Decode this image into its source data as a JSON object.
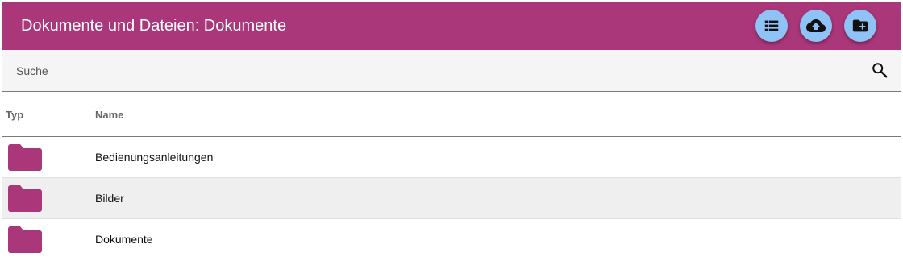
{
  "header": {
    "title": "Dokumente und Dateien: Dokumente",
    "accent_color": "#a9377a",
    "button_color": "#8fc2f5",
    "actions": [
      {
        "icon": "list-view-icon"
      },
      {
        "icon": "cloud-upload-icon"
      },
      {
        "icon": "create-folder-icon"
      }
    ]
  },
  "search": {
    "placeholder": "Suche",
    "icon": "search-icon"
  },
  "table": {
    "columns": [
      "Typ",
      "Name"
    ],
    "rows": [
      {
        "type": "folder-icon",
        "name": "Bedienungsanleitungen"
      },
      {
        "type": "folder-icon",
        "name": "Bilder"
      },
      {
        "type": "folder-icon",
        "name": "Dokumente"
      }
    ]
  }
}
